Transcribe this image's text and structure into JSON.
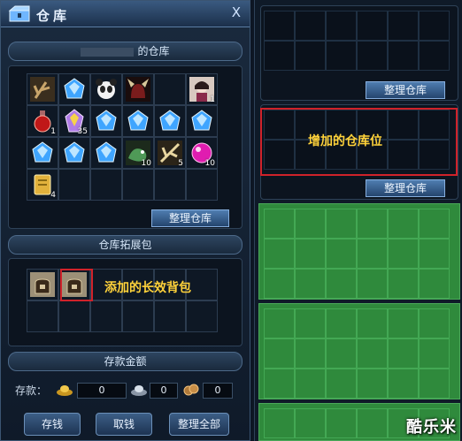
{
  "window": {
    "title": "仓库",
    "close_label": "X"
  },
  "storage": {
    "owner_header": "的仓库",
    "rows": [
      [
        {
          "icon": "antler-staff-icon",
          "count": ""
        },
        {
          "icon": "blue-gem-icon",
          "count": ""
        },
        {
          "icon": "panda-icon",
          "count": ""
        },
        {
          "icon": "horned-helmet-icon",
          "count": ""
        },
        {
          "icon": "empty",
          "count": ""
        },
        {
          "icon": "girl-avatar-icon",
          "count": "1"
        }
      ],
      [
        {
          "icon": "red-potion-icon",
          "count": "1"
        },
        {
          "icon": "purple-crystal-icon",
          "count": "35"
        },
        {
          "icon": "blue-gem-icon",
          "count": ""
        },
        {
          "icon": "blue-gem-icon",
          "count": ""
        },
        {
          "icon": "blue-gem-icon",
          "count": ""
        },
        {
          "icon": "blue-gem-icon",
          "count": ""
        }
      ],
      [
        {
          "icon": "blue-gem-icon",
          "count": ""
        },
        {
          "icon": "blue-gem-icon",
          "count": ""
        },
        {
          "icon": "blue-gem-icon",
          "count": ""
        },
        {
          "icon": "green-dragon-icon",
          "count": "10"
        },
        {
          "icon": "bone-branch-icon",
          "count": "5"
        },
        {
          "icon": "pink-orb-icon",
          "count": "10"
        }
      ],
      [
        {
          "icon": "gold-tablet-icon",
          "count": "4"
        },
        {
          "icon": "empty",
          "count": ""
        },
        {
          "icon": "empty",
          "count": ""
        },
        {
          "icon": "empty",
          "count": ""
        },
        {
          "icon": "empty",
          "count": ""
        },
        {
          "icon": "empty",
          "count": ""
        }
      ]
    ],
    "sort_button": "整理仓库"
  },
  "expansion": {
    "header": "仓库拓展包",
    "note": "添加的长效背包",
    "slots": [
      "bag-icon",
      "bag-icon",
      "empty",
      "empty",
      "empty",
      "empty",
      "empty",
      "empty",
      "empty",
      "empty",
      "empty",
      "empty"
    ]
  },
  "deposit": {
    "header": "存款金额",
    "label": "存款：",
    "gold": "0",
    "silver": "0",
    "copper": "0"
  },
  "actions": {
    "store": "存钱",
    "withdraw": "取钱",
    "sort_all": "整理全部"
  },
  "right": {
    "sort_button_1": "整理仓库",
    "added_note": "增加的仓库位",
    "sort_button_2": "整理仓库"
  },
  "watermark": "酷乐米",
  "colors": {
    "highlight_red": "#d0222a",
    "note_yellow": "#ffd23a",
    "slot_green": "#2f8a3c"
  }
}
